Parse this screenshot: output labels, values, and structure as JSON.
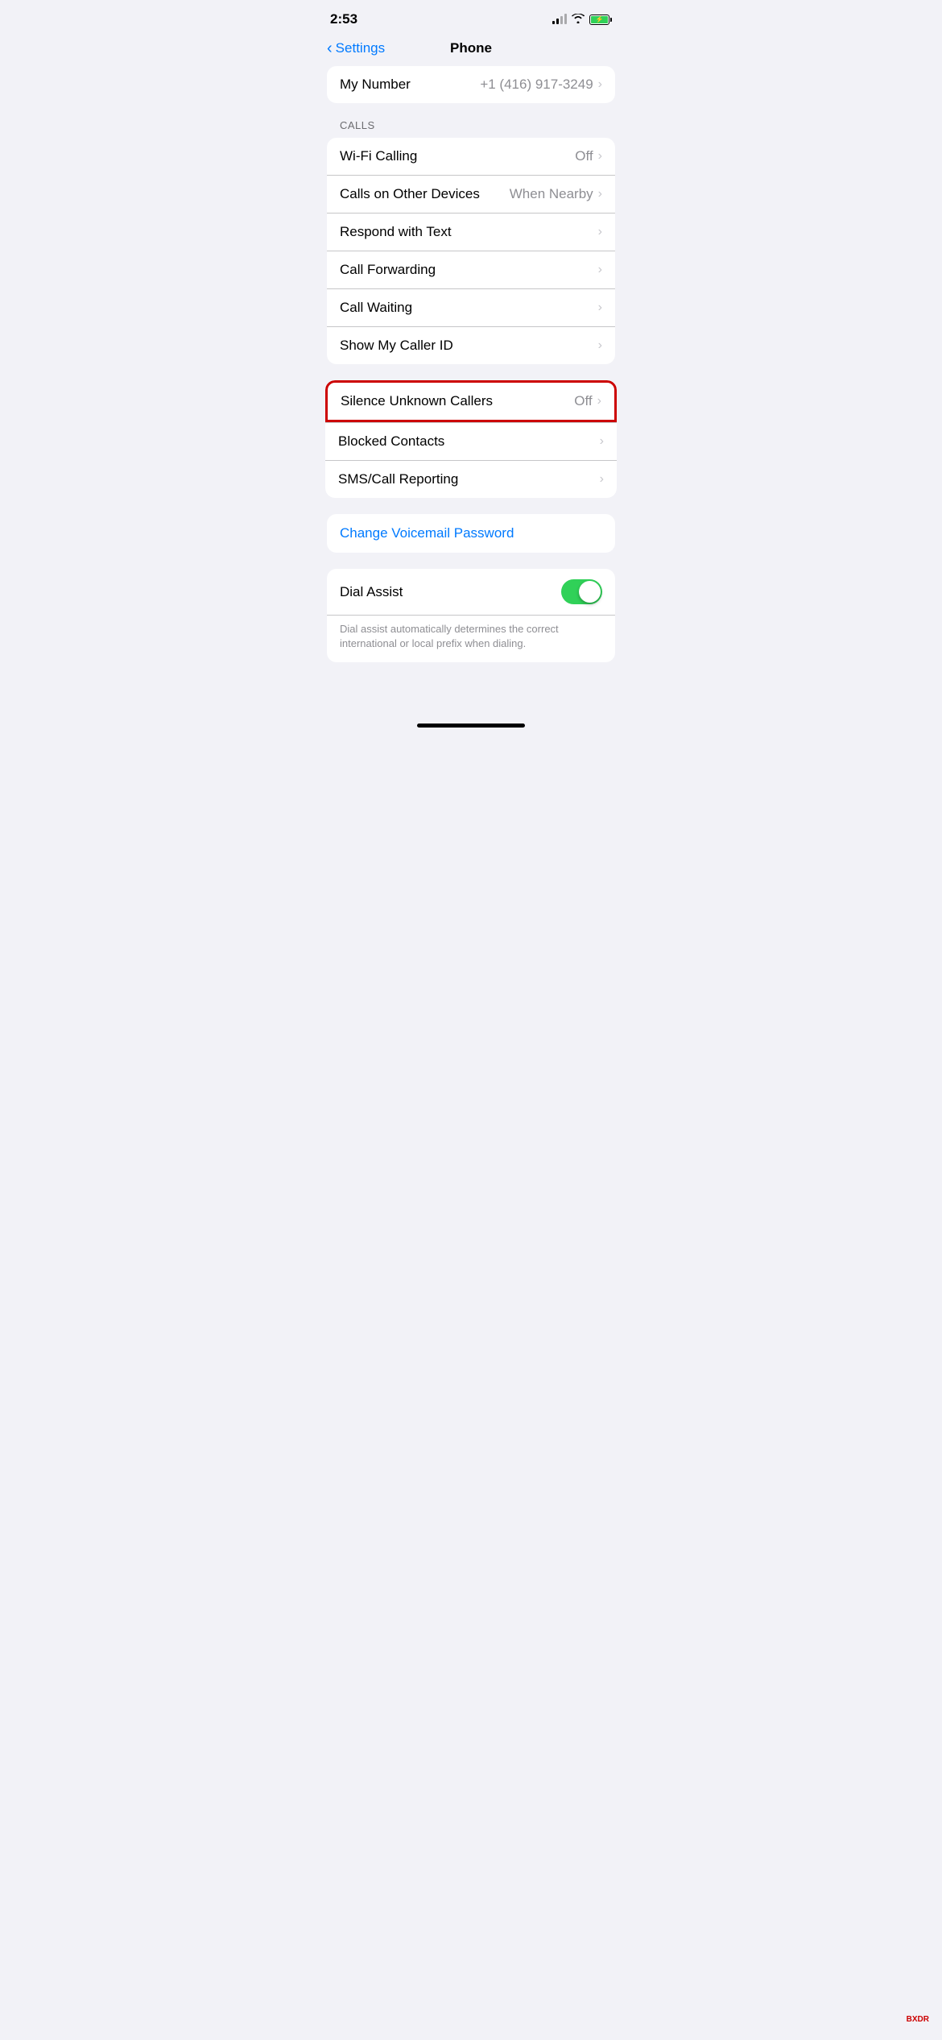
{
  "statusBar": {
    "time": "2:53"
  },
  "navBar": {
    "backLabel": "Settings",
    "title": "Phone"
  },
  "myNumber": {
    "label": "My Number",
    "value": "+1 (416) 917-3249"
  },
  "callsSection": {
    "sectionLabel": "CALLS",
    "rows": [
      {
        "label": "Wi-Fi Calling",
        "value": "Off",
        "hasChevron": true
      },
      {
        "label": "Calls on Other Devices",
        "value": "When Nearby",
        "hasChevron": true
      },
      {
        "label": "Respond with Text",
        "value": "",
        "hasChevron": true
      },
      {
        "label": "Call Forwarding",
        "value": "",
        "hasChevron": true
      },
      {
        "label": "Call Waiting",
        "value": "",
        "hasChevron": true
      },
      {
        "label": "Show My Caller ID",
        "value": "",
        "hasChevron": true
      }
    ]
  },
  "silenceRow": {
    "label": "Silence Unknown Callers",
    "value": "Off",
    "hasChevron": true
  },
  "blockedContactsRow": {
    "label": "Blocked Contacts",
    "value": "",
    "hasChevron": true
  },
  "smsCallReportingRow": {
    "label": "SMS/Call Reporting",
    "value": "",
    "hasChevron": true
  },
  "voicemail": {
    "label": "Change Voicemail Password"
  },
  "dialAssist": {
    "label": "Dial Assist",
    "description": "Dial assist automatically determines the correct international or local prefix when dialing.",
    "toggleOn": true
  },
  "homeBar": "home-bar"
}
